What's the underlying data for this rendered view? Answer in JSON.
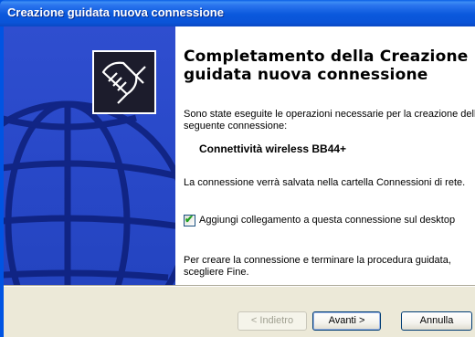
{
  "window": {
    "title": "Creazione guidata nuova connessione"
  },
  "wizard": {
    "heading": "Completamento della Creazione guidata nuova connessione",
    "intro": "Sono state eseguite le operazioni necessarie per la creazione della seguente connessione:",
    "connection_name": "Connettività wireless BB44+",
    "save_note": "La connessione verrà salvata nella cartella Connessioni di rete.",
    "shortcut_checkbox": {
      "label": "Aggiungi collegamento a questa connessione sul desktop",
      "checked": true
    },
    "finish_note": "Per creare la connessione e terminare la procedura guidata, scegliere Fine."
  },
  "buttons": {
    "back": "< Indietro",
    "next": "Avanti >",
    "cancel": "Annulla"
  },
  "icons": {
    "logo": "network-plug-icon",
    "check": "checkmark-icon"
  },
  "colors": {
    "titlebar": "#0a58dc",
    "left_panel": "#2848c8",
    "dialog_bg": "#ece9d8"
  }
}
